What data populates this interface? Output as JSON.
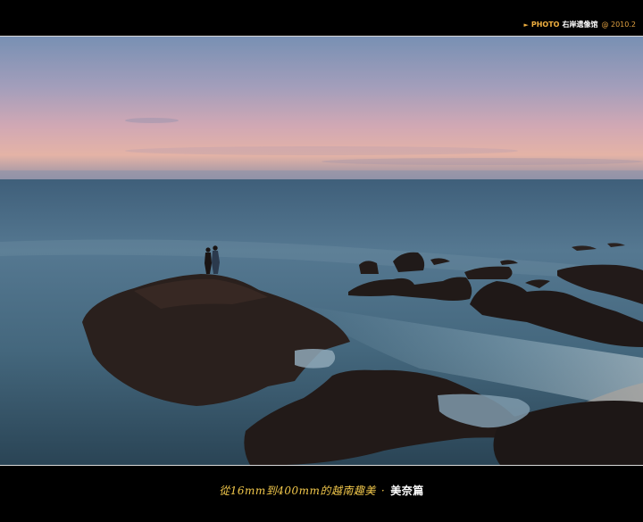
{
  "header": {
    "credit_arrow": "►",
    "credit_label": "PHOTO",
    "credit_name": "右岸遗像馆",
    "credit_year": "@ 2010.2"
  },
  "photo": {
    "scene": "coastal dusk seascape",
    "colors": {
      "sky_top": "#6f8bb0",
      "sky_mid": "#c9a7b6",
      "horizon_glow": "#e9b79e",
      "sea": "#4f7188",
      "rocks": "#241c1a"
    }
  },
  "footer": {
    "caption_main": "從16mm到400mm的越南趣美",
    "caption_sep": "·",
    "caption_series": "美奈篇"
  }
}
